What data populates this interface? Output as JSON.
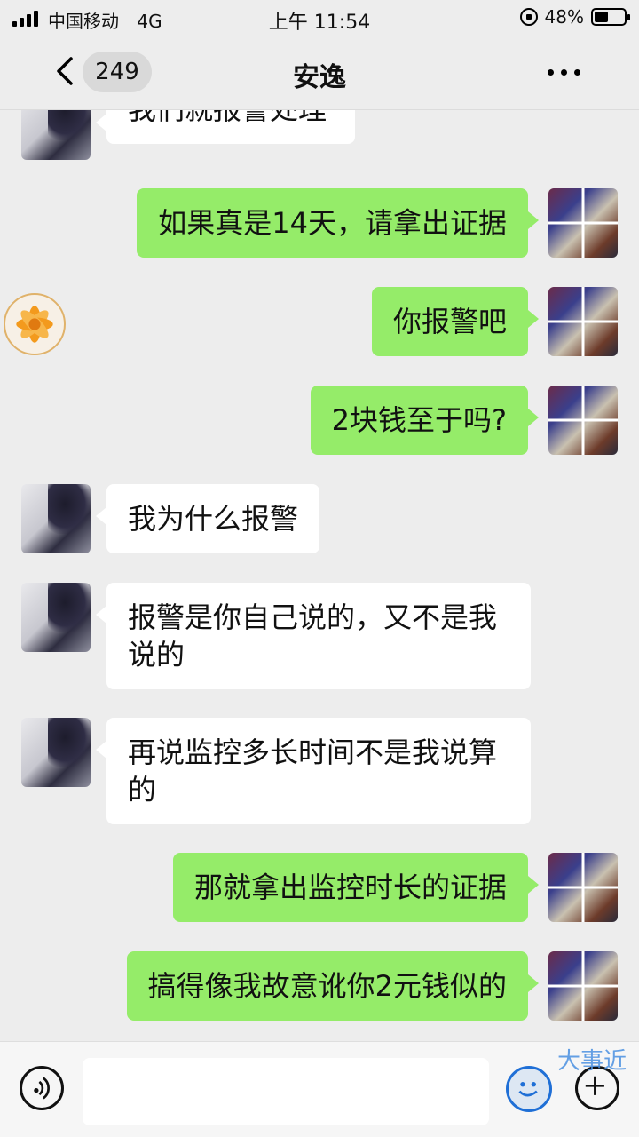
{
  "status_bar": {
    "carrier": "中国移动",
    "network": "4G",
    "time": "上午 11:54",
    "battery": "48%",
    "battery_level": 0.48
  },
  "nav": {
    "unread_count": "249",
    "title": "安逸"
  },
  "messages": [
    {
      "side": "left",
      "avatar": "girl-avatar",
      "text": "我们就报警处理"
    },
    {
      "side": "right",
      "avatar": "collage-avatar",
      "text": "如果真是14天，请拿出证据"
    },
    {
      "side": "right",
      "avatar": "collage-avatar",
      "text": "你报警吧"
    },
    {
      "side": "right",
      "avatar": "collage-avatar",
      "text": "2块钱至于吗?"
    },
    {
      "side": "left",
      "avatar": "girl-avatar",
      "text": "我为什么报警"
    },
    {
      "side": "left",
      "avatar": "girl-avatar",
      "text": "报警是你自己说的，又不是我说的"
    },
    {
      "side": "left",
      "avatar": "girl-avatar",
      "text": "再说监控多长时间不是我说算的"
    },
    {
      "side": "right",
      "avatar": "collage-avatar",
      "text": "那就拿出监控时长的证据"
    },
    {
      "side": "right",
      "avatar": "collage-avatar",
      "text": "搞得像我故意讹你2元钱似的"
    }
  ],
  "input_bar": {
    "value": "",
    "watermark": "大事近"
  },
  "icons": {
    "back": "back-chevron-icon",
    "more": "more-dots-icon",
    "voice": "voice-icon",
    "emoji": "emoji-icon",
    "plus": "plus-icon",
    "floating": "flower-avatar-icon"
  }
}
